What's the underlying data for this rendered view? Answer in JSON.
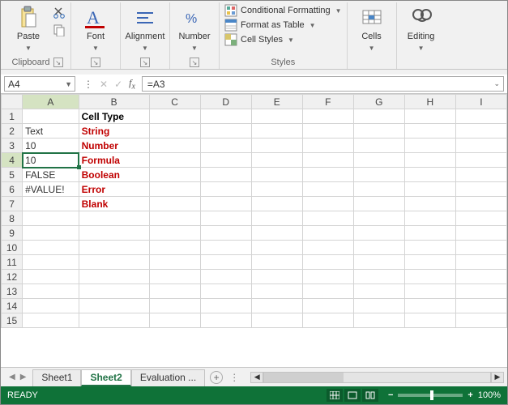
{
  "ribbon": {
    "clipboard": {
      "label": "Clipboard",
      "paste": "Paste"
    },
    "font": {
      "label": "Font"
    },
    "alignment": {
      "label": "Alignment"
    },
    "number": {
      "label": "Number"
    },
    "styles": {
      "label": "Styles",
      "cond_format": "Conditional Formatting",
      "format_table": "Format as Table",
      "cell_styles": "Cell Styles"
    },
    "cells": {
      "label": "Cells"
    },
    "editing": {
      "label": "Editing"
    }
  },
  "namebox": {
    "value": "A4"
  },
  "formula": {
    "value": "=A3"
  },
  "columns": [
    "A",
    "B",
    "C",
    "D",
    "E",
    "F",
    "G",
    "H",
    "I"
  ],
  "rows": [
    {
      "n": 1,
      "A": "",
      "B": "Cell Type",
      "b_class": "boldhdr"
    },
    {
      "n": 2,
      "A": "Text",
      "B": "String",
      "b_class": "redbold"
    },
    {
      "n": 3,
      "A": "10",
      "B": "Number",
      "b_class": "redbold"
    },
    {
      "n": 4,
      "A": "10",
      "B": "Formula",
      "b_class": "redbold",
      "selected": true
    },
    {
      "n": 5,
      "A": "FALSE",
      "B": "Boolean",
      "b_class": "redbold"
    },
    {
      "n": 6,
      "A": "#VALUE!",
      "B": "Error",
      "b_class": "redbold"
    },
    {
      "n": 7,
      "A": "",
      "B": "Blank",
      "b_class": "redbold"
    },
    {
      "n": 8
    },
    {
      "n": 9
    },
    {
      "n": 10
    },
    {
      "n": 11
    },
    {
      "n": 12
    },
    {
      "n": 13
    },
    {
      "n": 14
    },
    {
      "n": 15
    }
  ],
  "tabs": {
    "items": [
      {
        "name": "Sheet1",
        "active": false
      },
      {
        "name": "Sheet2",
        "active": true
      },
      {
        "name": "Evaluation  ...",
        "active": false
      }
    ]
  },
  "status": {
    "ready": "READY",
    "zoom": "100%"
  }
}
